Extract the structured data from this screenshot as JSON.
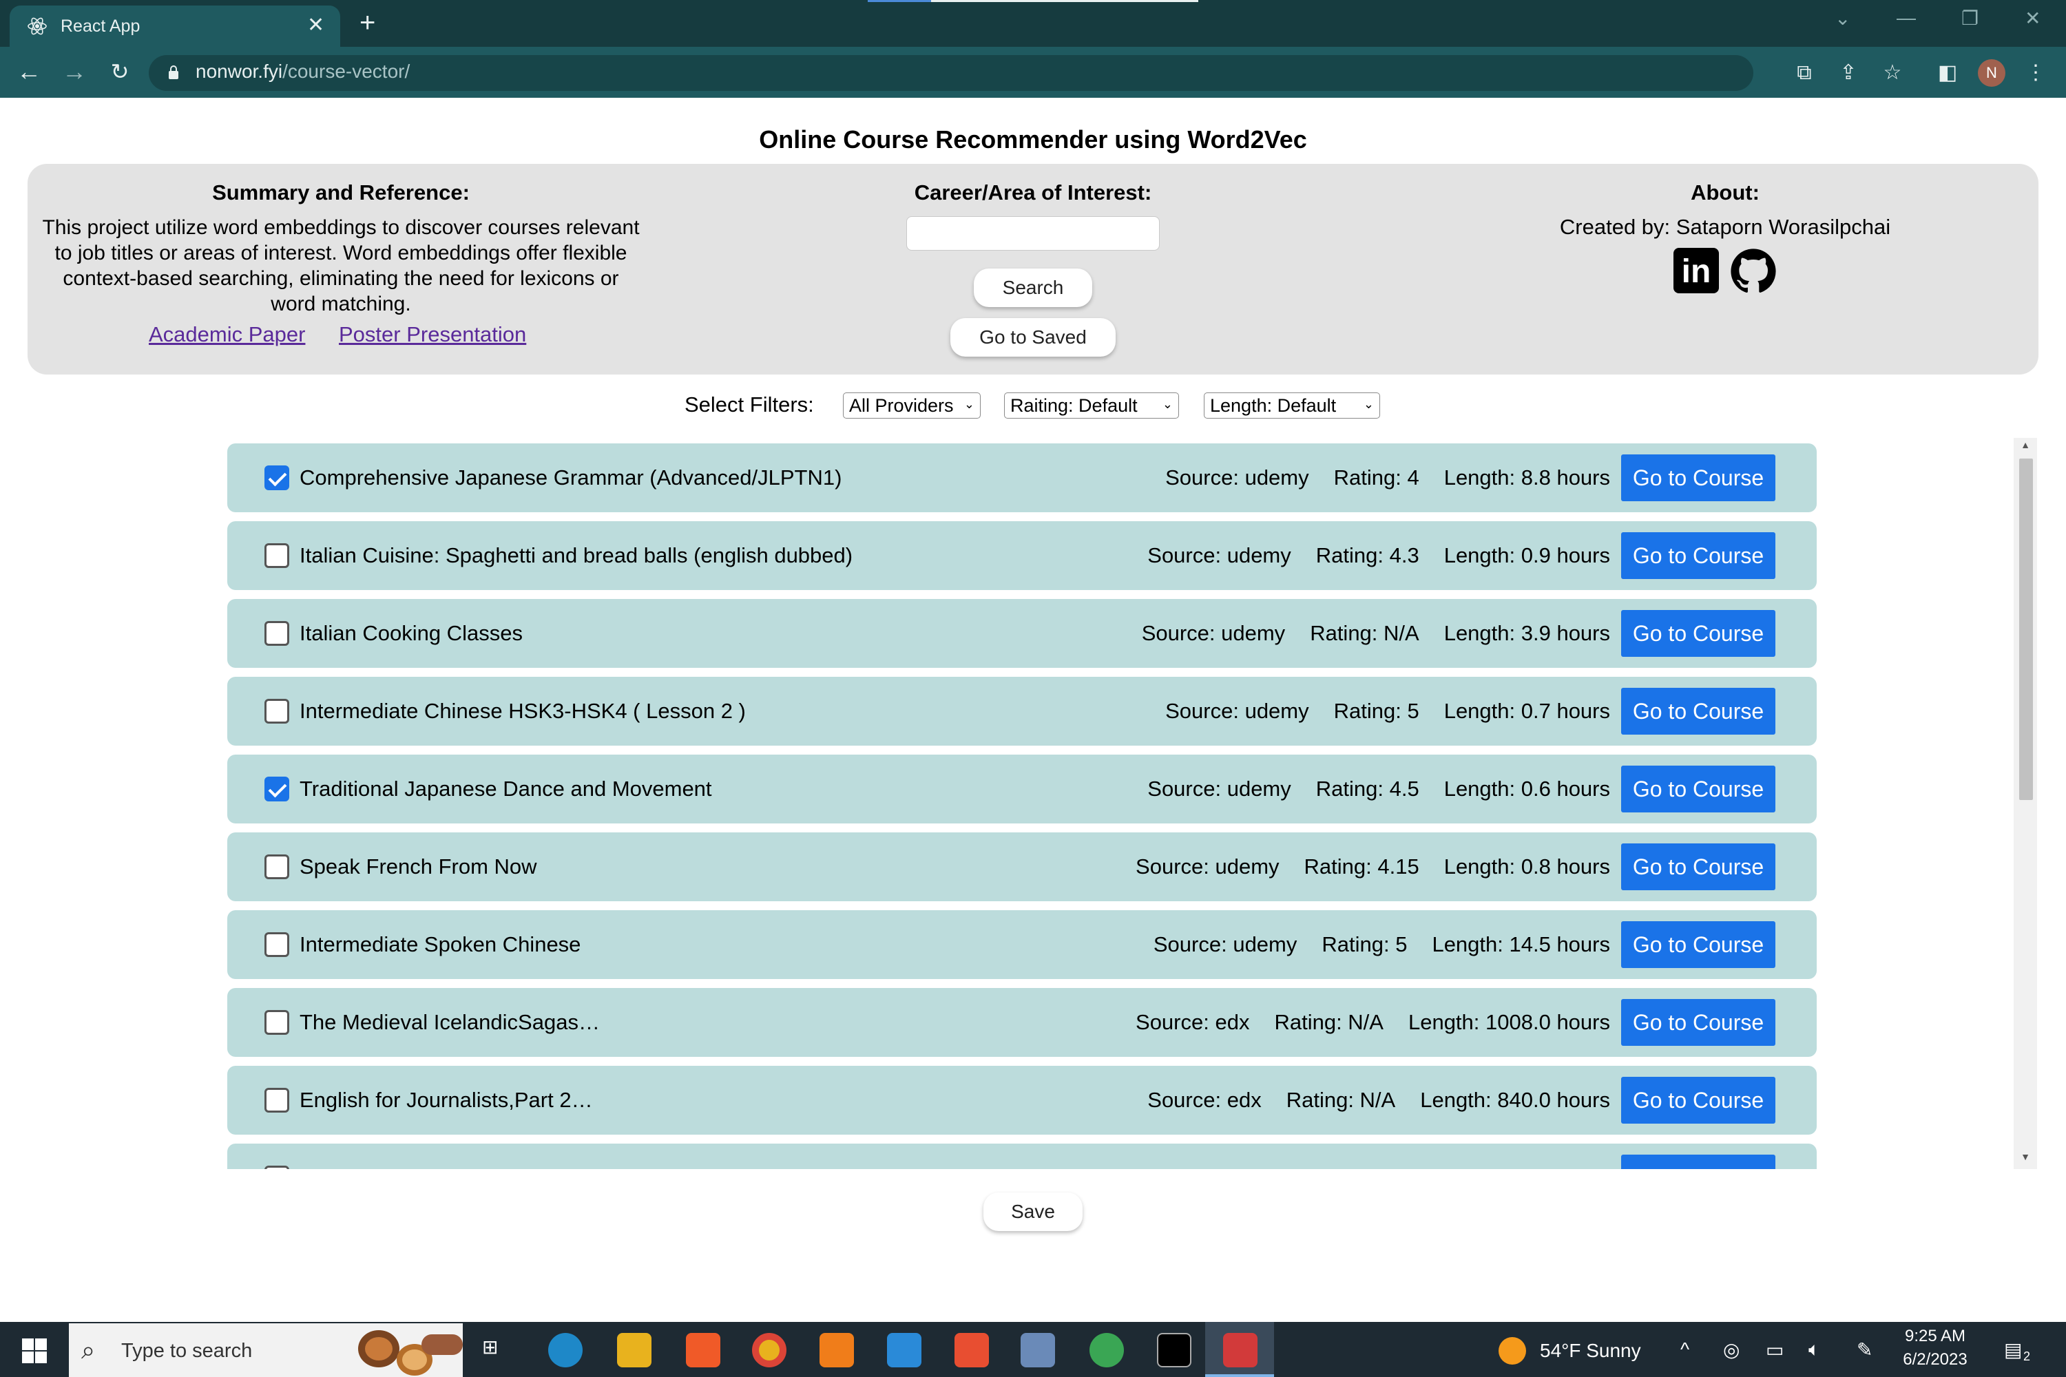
{
  "browser": {
    "tab_title": "React App",
    "url_domain": "nonwor.fyi",
    "url_path": "/course-vector/",
    "profile_initial": "N"
  },
  "page": {
    "title": "Online Course Recommender using Word2Vec"
  },
  "summary": {
    "heading": "Summary and Reference:",
    "text": "This project utilize word embeddings to discover courses relevant to job titles or areas of interest. Word embeddings offer flexible context-based searching, eliminating the need for lexicons or word matching.",
    "link_paper": "Academic Paper",
    "link_poster": "Poster Presentation"
  },
  "search": {
    "heading": "Career/Area of Interest:",
    "input_value": "",
    "search_label": "Search",
    "saved_label": "Go to Saved"
  },
  "about": {
    "heading": "About:",
    "created_by": "Created by: Sataporn Worasilpchai"
  },
  "filters": {
    "label": "Select Filters:",
    "provider": "All Providers",
    "rating": "Raiting: Default",
    "length": "Length: Default"
  },
  "courses": [
    {
      "title": "Comprehensive Japanese Grammar (Advanced/JLPTN1)",
      "source": "Source: udemy",
      "rating": "Rating: 4",
      "length": "Length: 8.8 hours",
      "checked": true,
      "button": "Go to Course"
    },
    {
      "title": "Italian Cuisine: Spaghetti and bread balls (english dubbed)",
      "source": "Source: udemy",
      "rating": "Rating: 4.3",
      "length": "Length: 0.9 hours",
      "checked": false,
      "button": "Go to Course"
    },
    {
      "title": "Italian Cooking Classes",
      "source": "Source: udemy",
      "rating": "Rating: N/A",
      "length": "Length: 3.9 hours",
      "checked": false,
      "button": "Go to Course"
    },
    {
      "title": "Intermediate Chinese HSK3-HSK4 ( Lesson 2 )",
      "source": "Source: udemy",
      "rating": "Rating: 5",
      "length": "Length: 0.7 hours",
      "checked": false,
      "button": "Go to Course"
    },
    {
      "title": "Traditional Japanese Dance and Movement",
      "source": "Source: udemy",
      "rating": "Rating: 4.5",
      "length": "Length: 0.6 hours",
      "checked": true,
      "button": "Go to Course"
    },
    {
      "title": "Speak French From Now",
      "source": "Source: udemy",
      "rating": "Rating: 4.15",
      "length": "Length: 0.8 hours",
      "checked": false,
      "button": "Go to Course"
    },
    {
      "title": "Intermediate Spoken Chinese",
      "source": "Source: udemy",
      "rating": "Rating: 5",
      "length": "Length: 14.5 hours",
      "checked": false,
      "button": "Go to Course"
    },
    {
      "title": "The Medieval IcelandicSagas…",
      "source": "Source: edx",
      "rating": "Rating: N/A",
      "length": "Length: 1008.0 hours",
      "checked": false,
      "button": "Go to Course"
    },
    {
      "title": "English for Journalists,Part 2…",
      "source": "Source: edx",
      "rating": "Rating: N/A",
      "length": "Length: 840.0 hours",
      "checked": false,
      "button": "Go to Course"
    },
    {
      "title": "",
      "source": "",
      "rating": "",
      "length": "",
      "checked": false,
      "button": ""
    }
  ],
  "save_label": "Save",
  "taskbar": {
    "search_placeholder": "Type to search",
    "weather": "54°F  Sunny",
    "time": "9:25 AM",
    "date": "6/2/2023",
    "notifications": "2"
  },
  "colors": {
    "accent": "#1a73e8",
    "row_bg": "#bcdcdc",
    "panel_bg": "#e3e3e3",
    "chrome_dark": "#163b3f",
    "chrome_bar": "#1f5a60"
  }
}
